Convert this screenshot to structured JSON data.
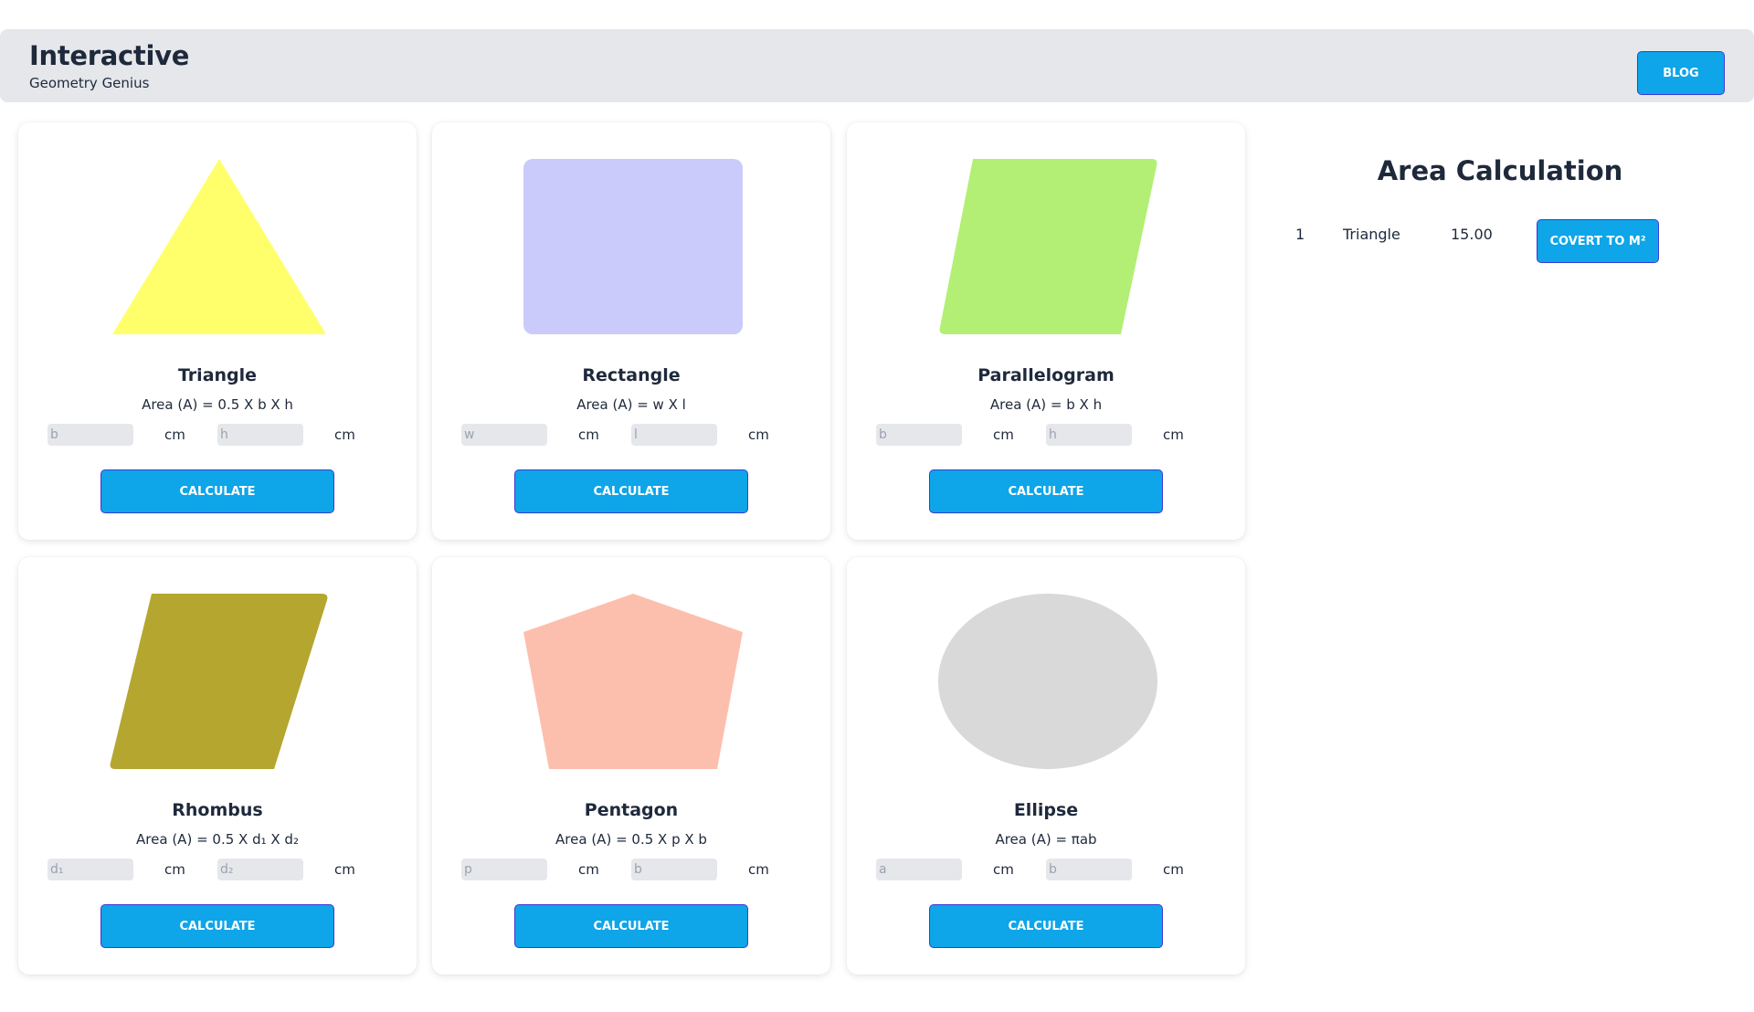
{
  "header": {
    "title": "Interactive",
    "subtitle": "Geometry Genius",
    "blog_label": "BLOG"
  },
  "unit_label": "cm",
  "calculate_label": "CALCULATE",
  "shapes": [
    {
      "name": "Triangle",
      "formula": "Area (A) = 0.5 X b X h",
      "input1_placeholder": "b",
      "input2_placeholder": "h",
      "color": "#ffff6b",
      "icon": "triangle-icon"
    },
    {
      "name": "Rectangle",
      "formula": "Area (A) = w X l",
      "input1_placeholder": "w",
      "input2_placeholder": "l",
      "color": "#cacbfb",
      "icon": "rectangle-icon"
    },
    {
      "name": "Parallelogram",
      "formula": "Area (A) = b X h",
      "input1_placeholder": "b",
      "input2_placeholder": "h",
      "color": "#b3ef75",
      "icon": "parallelogram-icon"
    },
    {
      "name": "Rhombus",
      "formula": "Area (A) = 0.5 X d₁ X d₂",
      "input1_placeholder": "d₁",
      "input2_placeholder": "d₂",
      "color": "#b4a62f",
      "icon": "rhombus-icon"
    },
    {
      "name": "Pentagon",
      "formula": "Area (A) = 0.5 X p X b",
      "input1_placeholder": "p",
      "input2_placeholder": "b",
      "color": "#fdbfad",
      "icon": "pentagon-icon"
    },
    {
      "name": "Ellipse",
      "formula": "Area (A) = πab",
      "input1_placeholder": "a",
      "input2_placeholder": "b",
      "color": "#d9d9d9",
      "icon": "ellipse-icon"
    }
  ],
  "results": {
    "title": "Area Calculation",
    "rows": [
      {
        "index": "1",
        "shape": "Triangle",
        "value": "15.00",
        "convert_label": "COVERT TO M²"
      }
    ]
  }
}
